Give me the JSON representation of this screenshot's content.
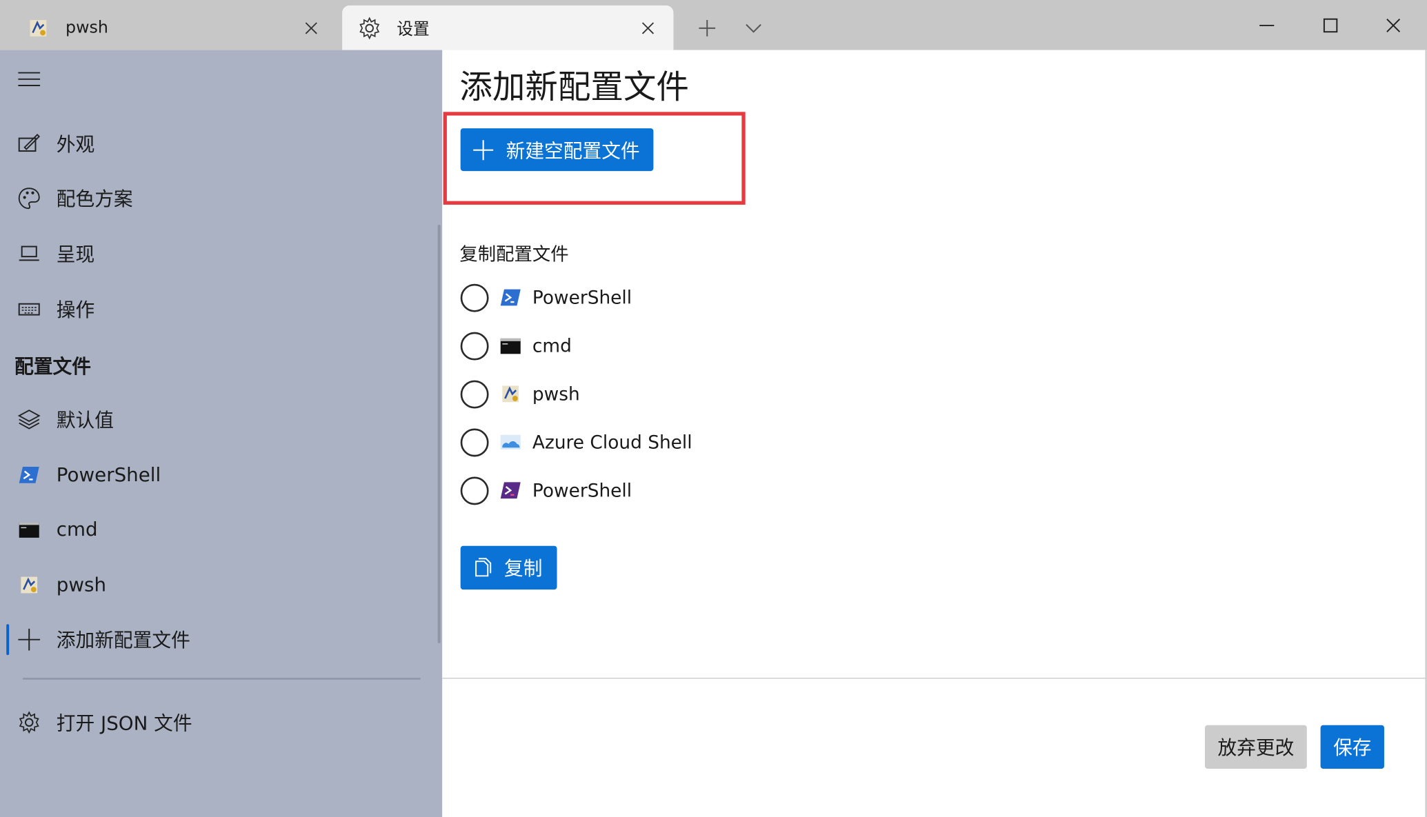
{
  "tabs": [
    {
      "label": "pwsh",
      "icon": "pwsh-icon"
    },
    {
      "label": "设置",
      "icon": "gear-icon"
    }
  ],
  "window_controls": [
    "minimize",
    "maximize",
    "close"
  ],
  "sidebar": {
    "items": [
      {
        "label": "外观",
        "icon": "appearance-icon"
      },
      {
        "label": "配色方案",
        "icon": "palette-icon"
      },
      {
        "label": "呈现",
        "icon": "rendering-icon"
      },
      {
        "label": "操作",
        "icon": "keyboard-icon"
      }
    ],
    "section_title": "配置文件",
    "profiles": [
      {
        "label": "默认值",
        "icon": "layers-icon"
      },
      {
        "label": "PowerShell",
        "icon": "powershell-icon"
      },
      {
        "label": "cmd",
        "icon": "cmd-icon"
      },
      {
        "label": "pwsh",
        "icon": "pwsh-icon"
      },
      {
        "label": "添加新配置文件",
        "icon": "plus-icon",
        "selected": true
      }
    ],
    "open_json": {
      "label": "打开 JSON 文件",
      "icon": "gear-icon"
    }
  },
  "main": {
    "title": "添加新配置文件",
    "new_button": "新建空配置文件",
    "duplicate_section": "复制配置文件",
    "profiles": [
      {
        "label": "PowerShell",
        "icon": "powershell-icon"
      },
      {
        "label": "cmd",
        "icon": "cmd-icon"
      },
      {
        "label": "pwsh",
        "icon": "pwsh-icon"
      },
      {
        "label": "Azure Cloud Shell",
        "icon": "azure-icon"
      },
      {
        "label": "PowerShell",
        "icon": "powershell-core-icon"
      }
    ],
    "copy_button": "复制"
  },
  "footer": {
    "discard": "放弃更改",
    "save": "保存"
  },
  "colors": {
    "accent": "#0a73d5",
    "sidebar_bg": "#aab2c4",
    "highlight": "#e53a40"
  }
}
